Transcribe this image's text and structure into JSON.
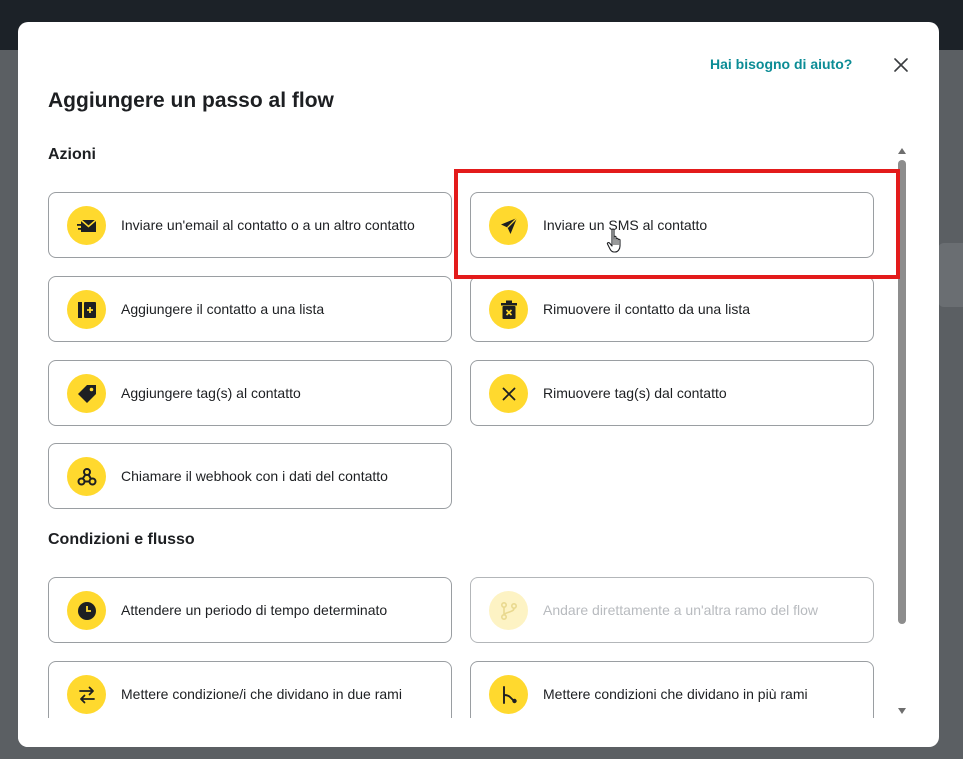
{
  "modal": {
    "help_link": "Hai bisogno di aiuto?",
    "title": "Aggiungere un passo al flow"
  },
  "sections": {
    "actions": {
      "title": "Azioni",
      "items": [
        {
          "label": "Inviare un'email al contatto o a un altro contatto",
          "icon": "email-send-icon"
        },
        {
          "label": "Inviare un SMS al contatto",
          "icon": "paper-plane-icon"
        },
        {
          "label": "Aggiungere il contatto a una lista",
          "icon": "add-to-list-icon"
        },
        {
          "label": "Rimuovere il contatto da una lista",
          "icon": "remove-from-list-icon"
        },
        {
          "label": "Aggiungere tag(s) al contatto",
          "icon": "tag-icon"
        },
        {
          "label": "Rimuovere tag(s) dal contatto",
          "icon": "x-icon"
        },
        {
          "label": "Chiamare il webhook con i dati del contatto",
          "icon": "webhook-icon"
        }
      ]
    },
    "conditions": {
      "title": "Condizioni e flusso",
      "items": [
        {
          "label": "Attendere un periodo di tempo determinato",
          "icon": "clock-icon"
        },
        {
          "label": "Andare direttamente a un'altra ramo del flow",
          "icon": "branch-jump-icon",
          "disabled": true
        },
        {
          "label": "Mettere condizione/i che dividano in due rami",
          "icon": "split-arrows-icon"
        },
        {
          "label": "Mettere condizioni che dividano in più rami",
          "icon": "multi-branch-icon"
        }
      ]
    }
  },
  "colors": {
    "accent_yellow": "#ffd92e",
    "link_teal": "#0b8c95",
    "highlight_red": "#e31b1b"
  }
}
